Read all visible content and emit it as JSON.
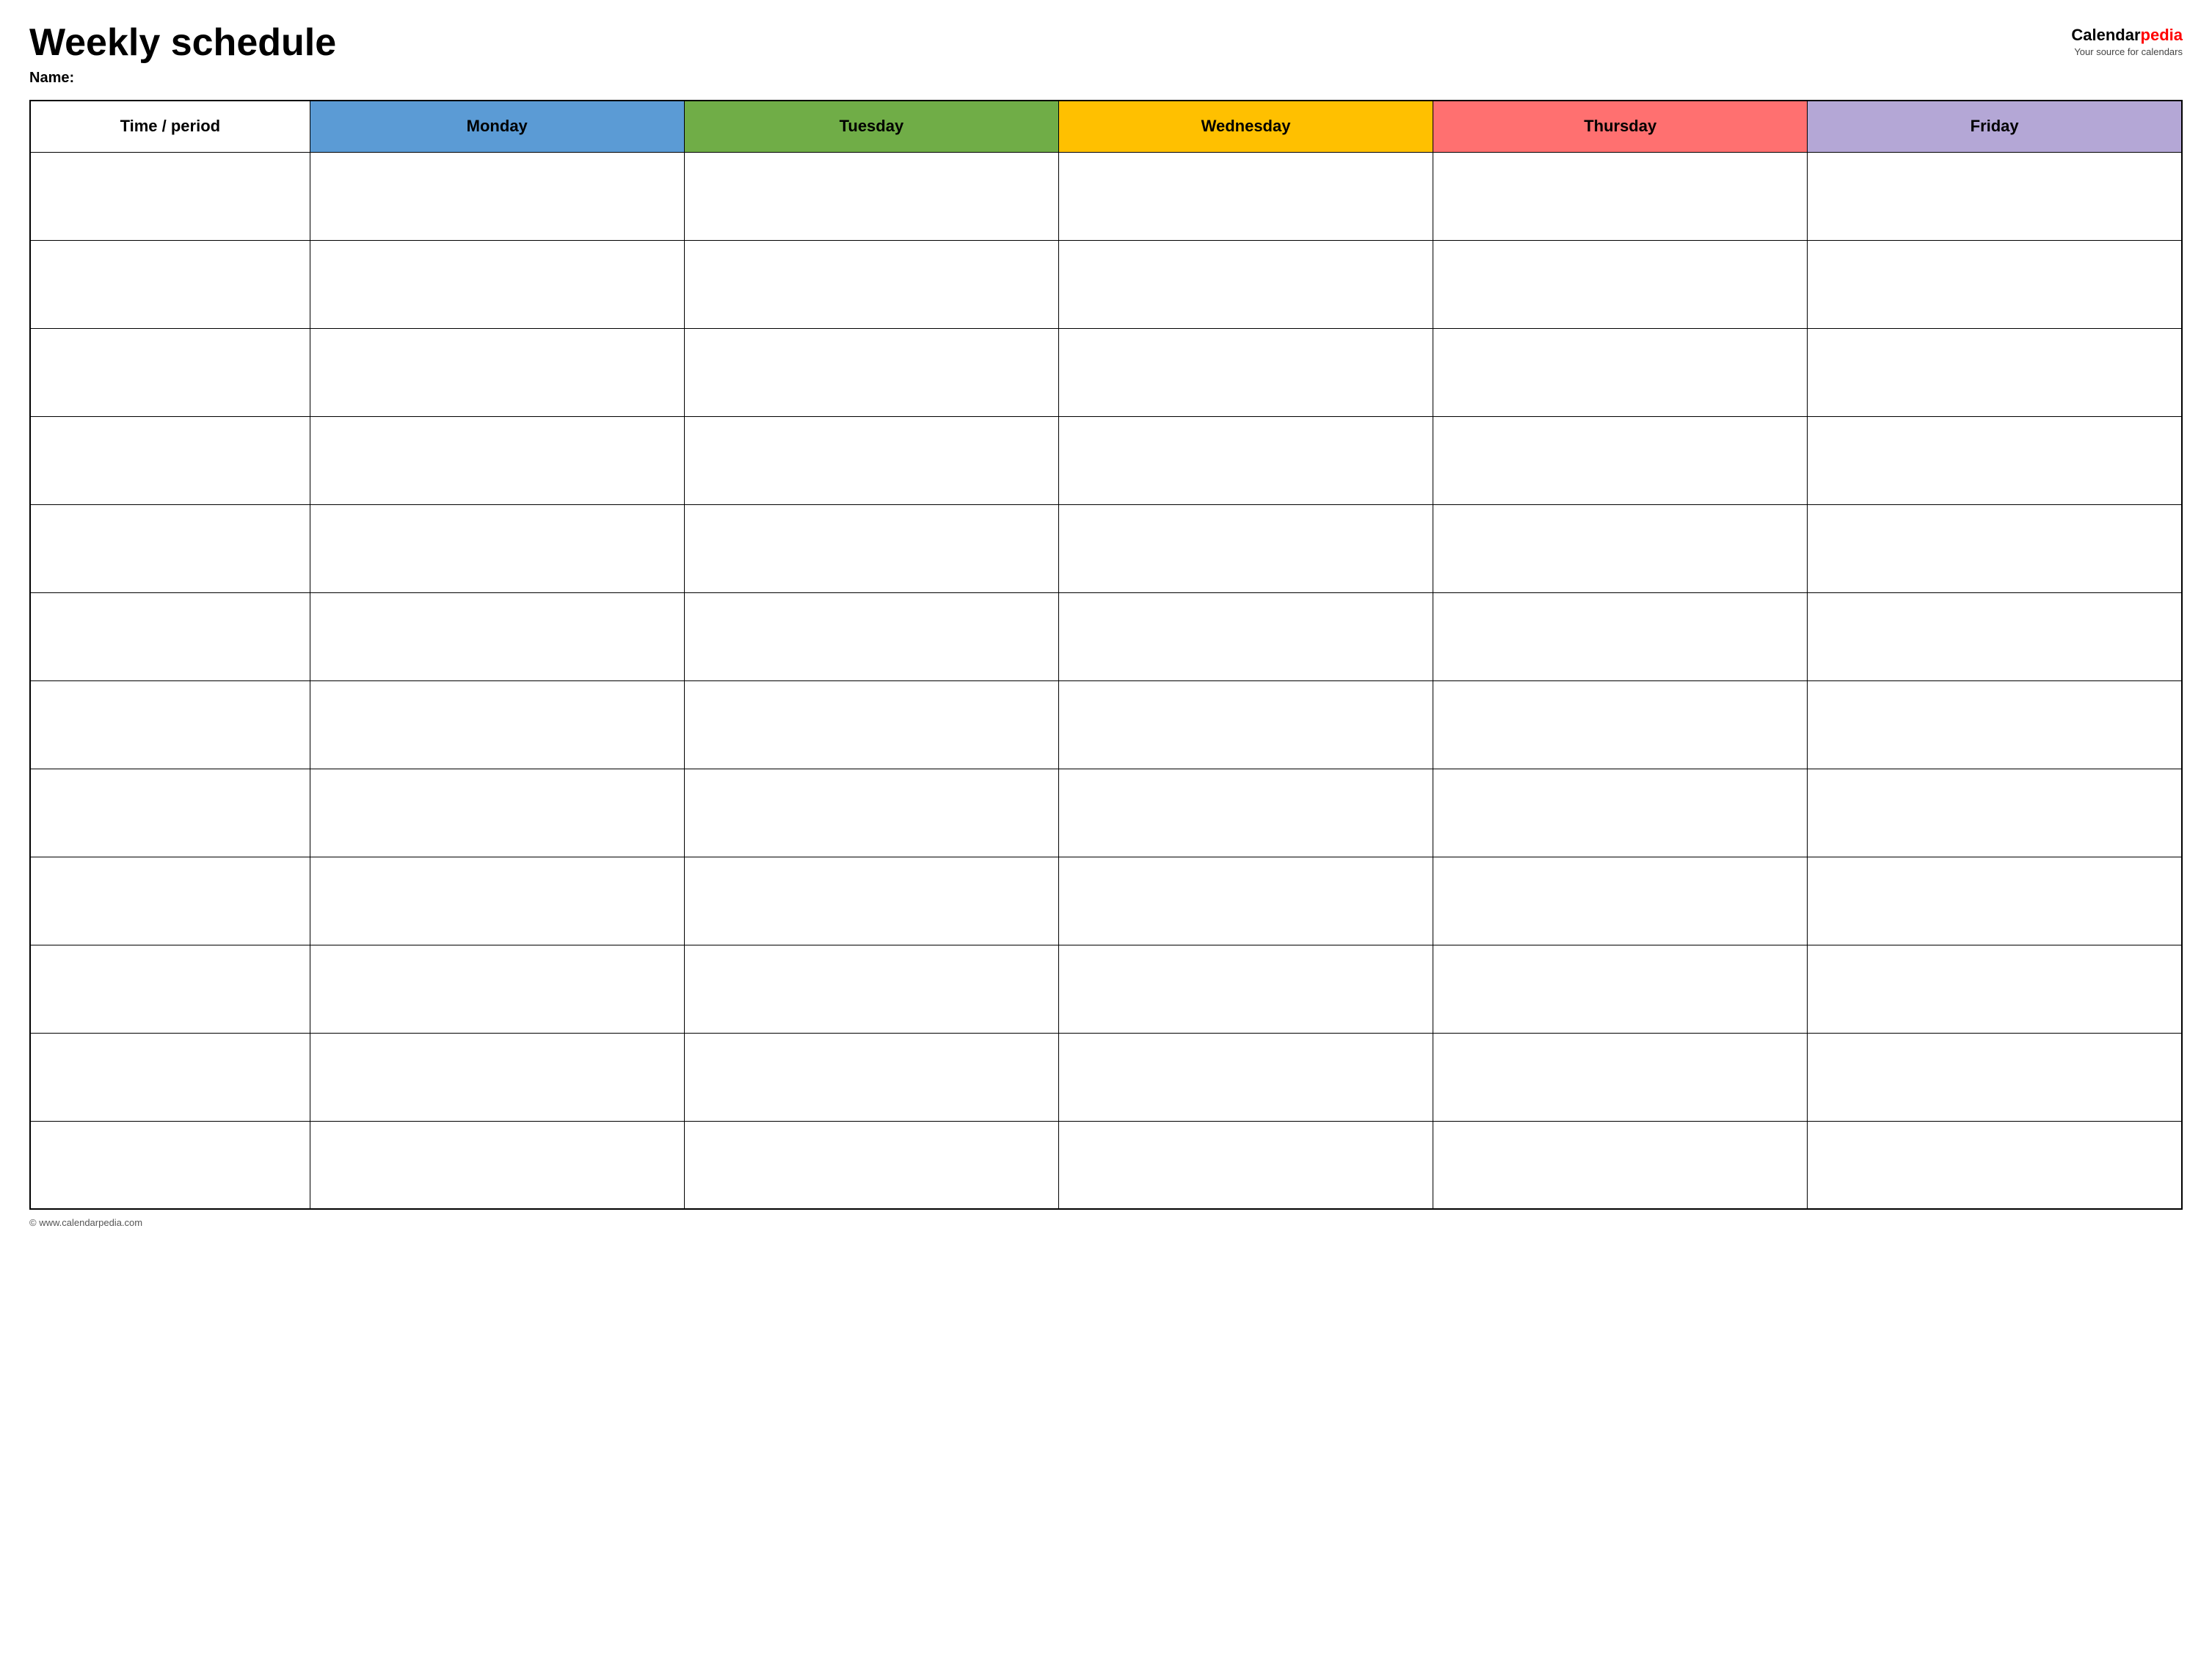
{
  "header": {
    "title": "Weekly schedule",
    "name_label": "Name:",
    "logo": {
      "brand_calendar": "Calendar",
      "brand_pedia": "pedia",
      "subtitle": "Your source for calendars"
    }
  },
  "table": {
    "columns": [
      {
        "key": "time",
        "label": "Time / period",
        "color": "#ffffff"
      },
      {
        "key": "monday",
        "label": "Monday",
        "color": "#5b9bd5"
      },
      {
        "key": "tuesday",
        "label": "Tuesday",
        "color": "#70ad47"
      },
      {
        "key": "wednesday",
        "label": "Wednesday",
        "color": "#ffc000"
      },
      {
        "key": "thursday",
        "label": "Thursday",
        "color": "#ff7070"
      },
      {
        "key": "friday",
        "label": "Friday",
        "color": "#b4a7d6"
      }
    ],
    "row_count": 12
  },
  "footer": {
    "url": "© www.calendarpedia.com"
  }
}
